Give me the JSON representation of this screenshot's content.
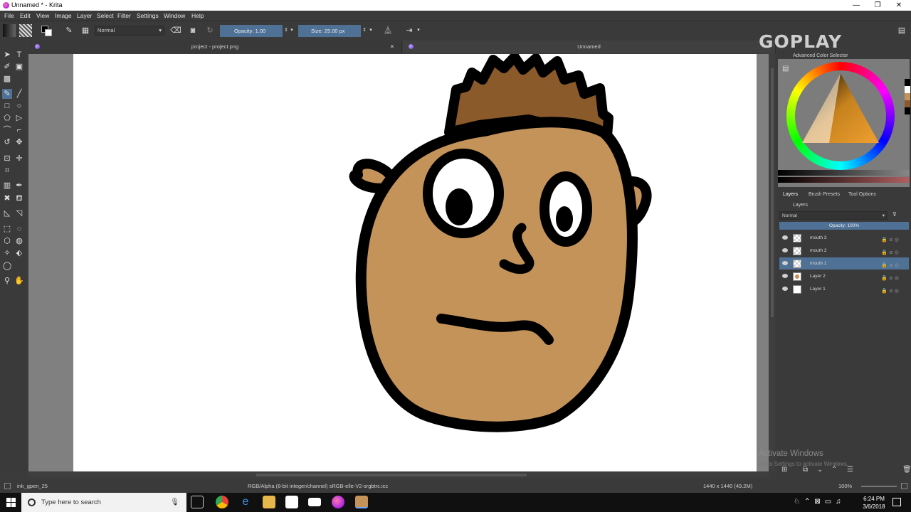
{
  "window": {
    "title": "Unnamed * - Krita",
    "controls": [
      "—",
      "❐",
      "✕"
    ]
  },
  "menu": [
    "File",
    "Edit",
    "View",
    "Image",
    "Layer",
    "Select",
    "Filter",
    "Settings",
    "Window",
    "Help"
  ],
  "tool_options": {
    "blend_mode": "Normal",
    "opacity_label": "Opacity:",
    "opacity_value": "1.00",
    "size_label": "Size:",
    "size_value": "25.00 px",
    "opacity_fill": 1.0
  },
  "tabs": [
    {
      "label": "project - project.png"
    },
    {
      "label": "Unnamed"
    }
  ],
  "docker": {
    "color_header": "Advanced Color Selector",
    "tabs": [
      "Layers",
      "Brush Presets",
      "Tool Options"
    ],
    "layers_header": "Layers",
    "layer_blend": "Normal",
    "layer_opacity": "Opacity:  100%",
    "layers": [
      {
        "name": "mouth 3",
        "active": false,
        "thumb": "check"
      },
      {
        "name": "mouth 2",
        "active": false,
        "thumb": "check"
      },
      {
        "name": "mouth 1",
        "active": true,
        "thumb": "check"
      },
      {
        "name": "Layer 2",
        "active": false,
        "thumb": "face"
      },
      {
        "name": "Layer 1",
        "active": false,
        "thumb": "white"
      }
    ]
  },
  "status": {
    "brush": "ink_gpen_25",
    "color_space": "RGB/Alpha (8-bit integer/channel)  sRGB-elle-V2-srgbtrc.icc",
    "dimensions": "1440 x 1440 (49.2M)",
    "zoom": "100%"
  },
  "taskbar": {
    "search_placeholder": "Type here to search",
    "time": "6:24 PM",
    "date": "3/6/2018"
  },
  "overlay": {
    "logo_text": "GOPLAY",
    "activate_title": "Activate Windows",
    "activate_sub": "Go to Settings to activate Windows."
  },
  "colors": {
    "skin": "#c4935a",
    "hair": "#8b5a2b",
    "accent": "#4f7196"
  }
}
